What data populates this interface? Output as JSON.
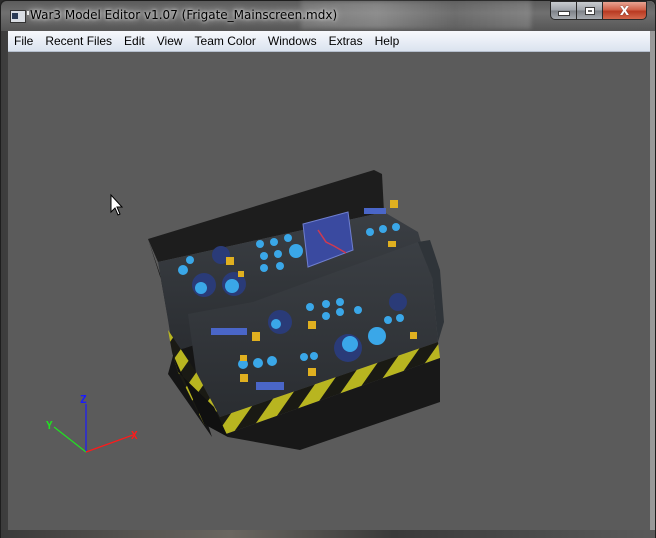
{
  "window": {
    "title": "War3 Model Editor v1.07 (Frigate_Mainscreen.mdx)",
    "icon": "app-window-icon",
    "controls": {
      "minimize_icon": "minimize-icon",
      "maximize_icon": "maximize-icon",
      "close_label": "X"
    }
  },
  "menubar": {
    "items": [
      {
        "label": "File"
      },
      {
        "label": "Recent Files"
      },
      {
        "label": "Edit"
      },
      {
        "label": "View"
      },
      {
        "label": "Team Color"
      },
      {
        "label": "Windows"
      },
      {
        "label": "Extras"
      },
      {
        "label": "Help"
      }
    ]
  },
  "viewport": {
    "background": "#5b5b5b",
    "model": "Frigate_Mainscreen",
    "axes": {
      "x": {
        "label": "X",
        "color": "#ff1a1a"
      },
      "y": {
        "label": "Y",
        "color": "#22e022"
      },
      "z": {
        "label": "Z",
        "color": "#1a1aff"
      }
    },
    "cursor": "arrow-cursor-icon"
  }
}
